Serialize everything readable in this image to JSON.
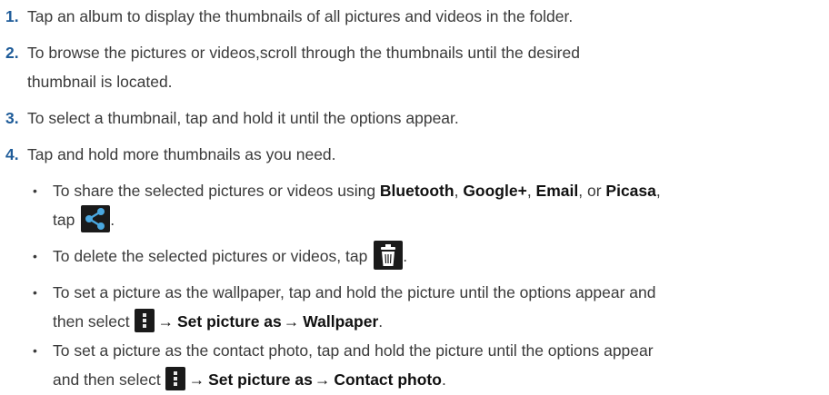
{
  "steps": [
    {
      "num": "1.",
      "text": "Tap an album to display the thumbnails of all pictures and videos in the folder."
    },
    {
      "num": "2.",
      "text": "To browse the pictures or videos,scroll through the thumbnails until the desired",
      "cont": "thumbnail is located."
    },
    {
      "num": "3.",
      "text": "To select a thumbnail, tap and hold it until the options appear."
    },
    {
      "num": "4.",
      "text": "Tap and hold more thumbnails as you need."
    }
  ],
  "bullets": {
    "share": {
      "pre": "To share the selected pictures or videos using ",
      "b1": "Bluetooth",
      "s1": ", ",
      "b2": "Google+",
      "s2": ", ",
      "b3": "Email",
      "s3": ", or ",
      "b4": "Picasa",
      "s4": ",",
      "tap": "tap ",
      "end": ".",
      "icon": "share-icon"
    },
    "delete": {
      "pre": "To delete the selected pictures or videos, tap ",
      "end": ".",
      "icon": "trash-icon"
    },
    "wallpaper": {
      "line1": "To set a picture as the wallpaper, tap and hold the picture until the options appear and",
      "then": "then select ",
      "arrow": "→",
      "b1": "Set picture as",
      "arrow2": "→",
      "b2": "Wallpaper",
      "end": ".",
      "icon": "menu-icon"
    },
    "contact": {
      "line1": "To set a picture as the contact photo, tap and hold the picture until the options appear",
      "then": "and then select ",
      "arrow": "→",
      "b1": "Set picture as",
      "arrow2": "→",
      "b2": "Contact photo",
      "end": ".",
      "icon": "menu-icon"
    }
  },
  "bullet_char": "•",
  "colors": {
    "step_number": "#1f5c99",
    "text": "#3a3a3a",
    "bold": "#111111",
    "icon_bg": "#1a1a1a",
    "share_icon": "#4aa8e0",
    "trash_icon": "#ffffff",
    "menu_icon": "#e8e8e8"
  }
}
